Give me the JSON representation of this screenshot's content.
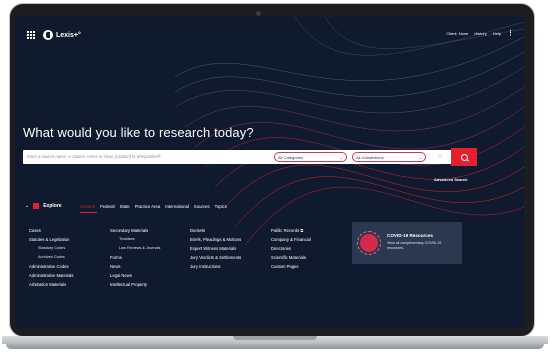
{
  "app": {
    "logo_text": "Lexis+°"
  },
  "topnav": {
    "client": "Client: None",
    "history": "History",
    "help": "Help",
    "more": "⋮"
  },
  "hero": {
    "headline": "What would you like to research today?"
  },
  "search": {
    "placeholder": "Enter a source name, a citation, terms or shep: [citation] to Shepardize®",
    "categories": "All Categories",
    "jurisdictions": "All Jurisdictions",
    "advanced": "Advanced Search"
  },
  "explore": {
    "label": "Explore",
    "tabs": [
      "Content",
      "Federal",
      "State",
      "Practice Area",
      "International",
      "Sources",
      "Topics"
    ]
  },
  "columns": {
    "col1": [
      {
        "label": "Cases",
        "sub": false
      },
      {
        "label": "Statutes & Legislation",
        "sub": false
      },
      {
        "label": "Statutory Codes",
        "sub": true
      },
      {
        "label": "Archived Codes",
        "sub": true
      },
      {
        "label": "Administrative Codes",
        "sub": false
      },
      {
        "label": "Administrative Materials",
        "sub": false
      },
      {
        "label": "Arbitration Materials",
        "sub": false
      }
    ],
    "col2": [
      {
        "label": "Secondary Materials",
        "sub": false
      },
      {
        "label": "Treatises",
        "sub": true
      },
      {
        "label": "Law Reviews & Journals",
        "sub": true
      },
      {
        "label": "Forms",
        "sub": false
      },
      {
        "label": "News",
        "sub": false
      },
      {
        "label": "Legal News",
        "sub": false
      },
      {
        "label": "Intellectual Property",
        "sub": false
      }
    ],
    "col3": [
      {
        "label": "Dockets",
        "sub": false
      },
      {
        "label": "Briefs, Pleadings & Motions",
        "sub": false
      },
      {
        "label": "Expert Witness Materials",
        "sub": false
      },
      {
        "label": "Jury Verdicts & Settlements",
        "sub": false
      },
      {
        "label": "Jury Instructions",
        "sub": false
      }
    ],
    "col4": [
      {
        "label": "Public Records ⧉",
        "sub": false
      },
      {
        "label": "Company & Financial",
        "sub": false
      },
      {
        "label": "Directories",
        "sub": false
      },
      {
        "label": "Scientific Materials",
        "sub": false
      },
      {
        "label": "Custom Pages",
        "sub": false
      }
    ]
  },
  "covid": {
    "title": "COVID-19 Resources",
    "desc": "View all complimentary COVID-19 resources."
  },
  "colors": {
    "accent": "#e4202e",
    "background": "#0f1a2e",
    "card": "#2a3950"
  },
  "icons": [
    "apps-grid-icon",
    "lexis-logo-icon",
    "chevron-down-icon",
    "explore-icon",
    "star-icon",
    "search-icon",
    "virus-icon",
    "kebab-menu-icon"
  ]
}
